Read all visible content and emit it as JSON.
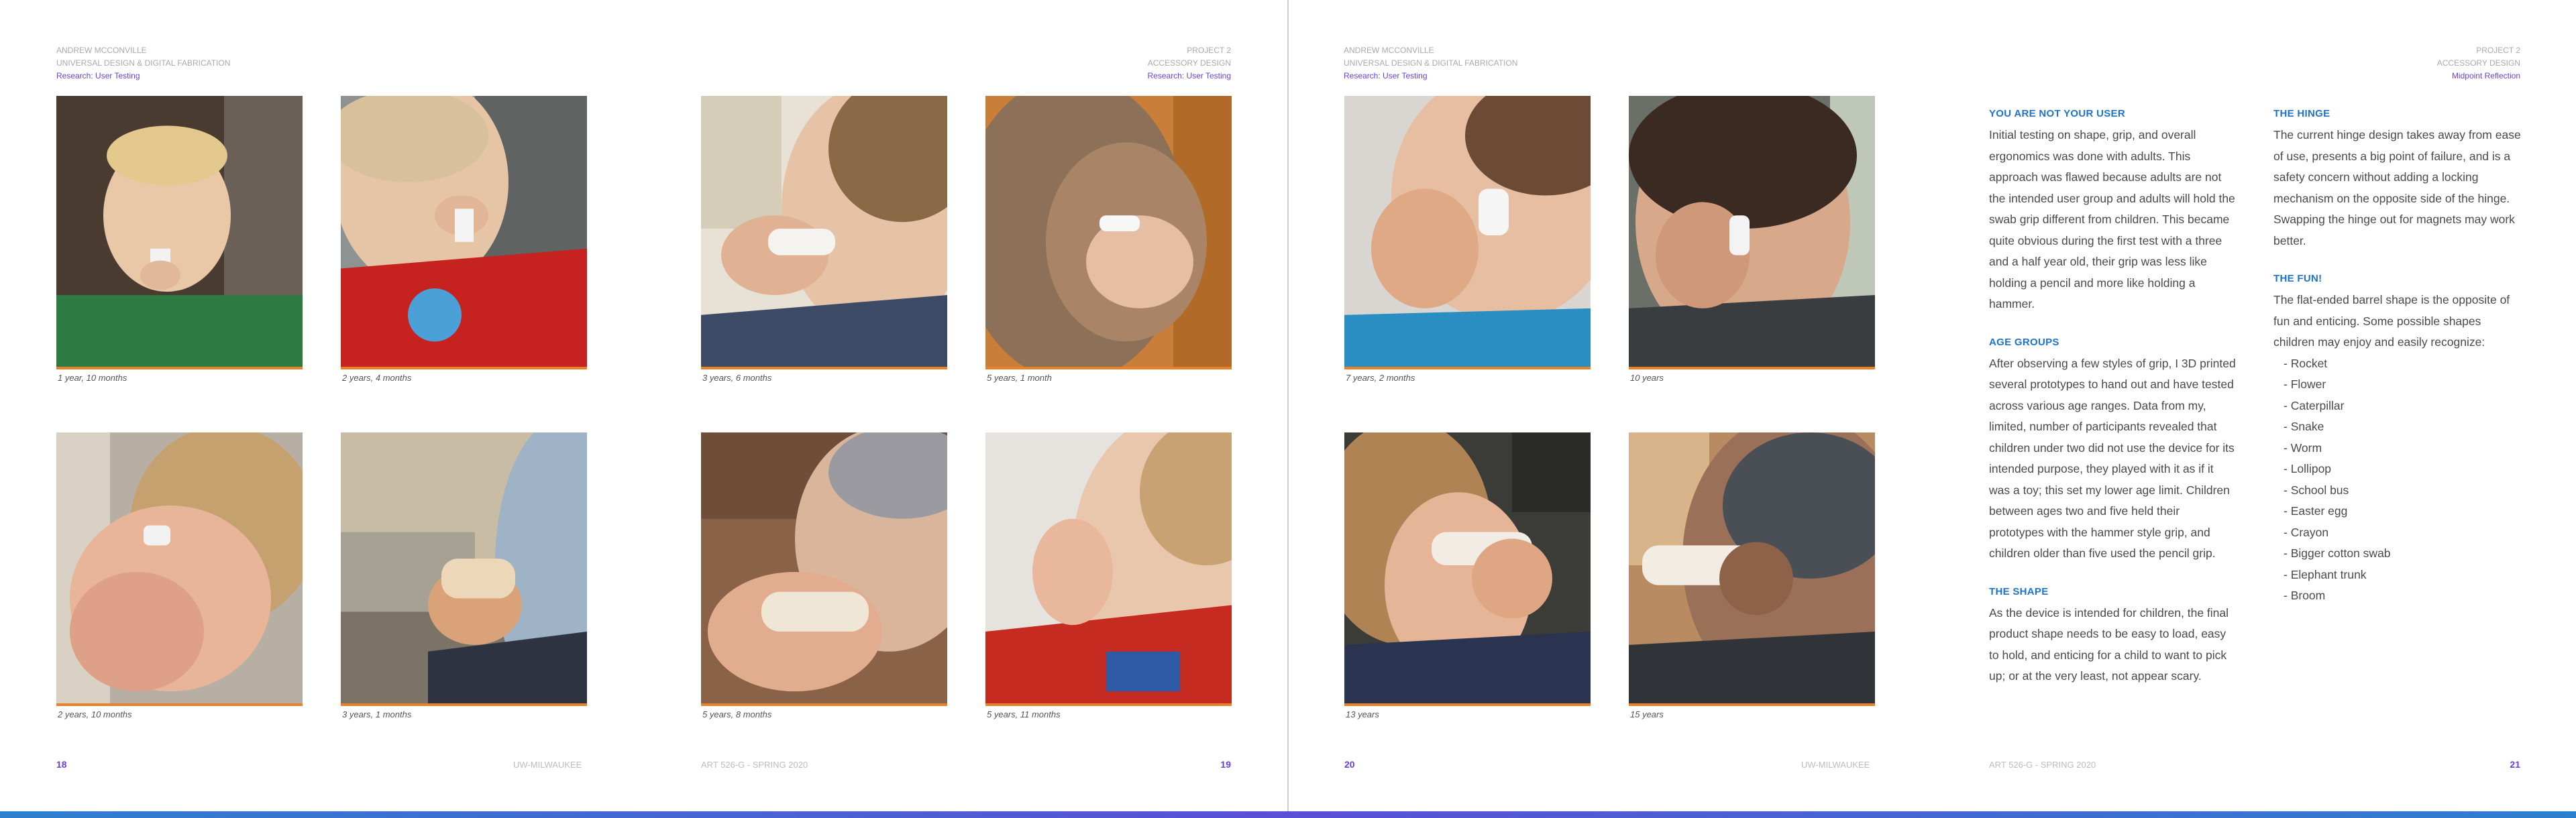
{
  "left_spread": {
    "header_left": {
      "author": "ANDREW MCCONVILLE",
      "course": "UNIVERSAL DESIGN & DIGITAL FABRICATION",
      "section": "Research: User Testing"
    },
    "header_right": {
      "project": "PROJECT 2",
      "title": "ACCESSORY DESIGN",
      "section": "Research: User Testing"
    },
    "photos": [
      {
        "caption": "1 year, 10 months"
      },
      {
        "caption": "2 years, 4 months"
      },
      {
        "caption": "3 years, 6 months"
      },
      {
        "caption": "5 years, 1 month"
      },
      {
        "caption": "2 years, 10 months"
      },
      {
        "caption": "3 years, 1 months"
      },
      {
        "caption": "5 years, 8 months"
      },
      {
        "caption": "5 years, 11 months"
      }
    ],
    "footer": {
      "page_left": "18",
      "school": "UW-MILWAUKEE",
      "course_code": "ART 526-G - SPRING 2020",
      "page_right": "19"
    }
  },
  "right_spread": {
    "header_left": {
      "author": "ANDREW MCCONVILLE",
      "course": "UNIVERSAL DESIGN & DIGITAL FABRICATION",
      "section": "Research: User Testing"
    },
    "header_right": {
      "project": "PROJECT 2",
      "title": "ACCESSORY DESIGN",
      "section": "Midpoint Reflection"
    },
    "photos": [
      {
        "caption": "7 years, 2 months"
      },
      {
        "caption": "10 years"
      },
      {
        "caption": "13 years"
      },
      {
        "caption": "15 years"
      }
    ],
    "sections_col1": [
      {
        "heading": "YOU ARE NOT YOUR USER",
        "body": "Initial testing on shape, grip, and overall ergonomics was done with adults. This approach was flawed because adults are not the intended user group and adults will hold the swab grip different from children. This became quite obvious during the first test with a three and a half year old, their grip was less like holding a pencil and more like holding a hammer."
      },
      {
        "heading": "AGE GROUPS",
        "body": "After observing a few styles of grip, I 3D printed several prototypes to hand out and have tested across various age ranges. Data from my, limited, number of participants revealed that children under two did not use the device for its intended purpose, they played with it as if it was a toy; this set my lower age limit. Children between ages two and five held their prototypes with the hammer style grip, and children older than five used the pencil grip."
      },
      {
        "heading": "THE SHAPE",
        "body": "As the device is intended for children, the final product shape needs to be easy to load, easy to hold, and enticing for a child to want to pick up; or at the very least, not appear scary."
      }
    ],
    "sections_col2": {
      "hinge_heading": "THE HINGE",
      "hinge_body": "The current hinge design takes away from ease of use, presents a big point of failure, and is a safety concern without adding a locking mechanism on the opposite side of the hinge. Swapping the hinge out for magnets may work better.",
      "fun_heading": "THE FUN!",
      "fun_body": "The flat-ended barrel shape is the opposite of fun and enticing. Some possible shapes children may enjoy and easily recognize:",
      "shapes": [
        "Rocket",
        "Flower",
        "Caterpillar",
        "Snake",
        "Worm",
        "Lollipop",
        "School bus",
        "Easter egg",
        "Crayon",
        "Bigger cotton swab",
        "Elephant trunk",
        "Broom"
      ]
    },
    "footer": {
      "page_left": "20",
      "school": "UW-MILWAUKEE",
      "course_code": "ART 526-G - SPRING 2020",
      "page_right": "21"
    }
  },
  "colors": {
    "accent": "#6a3fd8",
    "heading_blue": "#1f73c6",
    "photo_border": "#e8822a"
  }
}
